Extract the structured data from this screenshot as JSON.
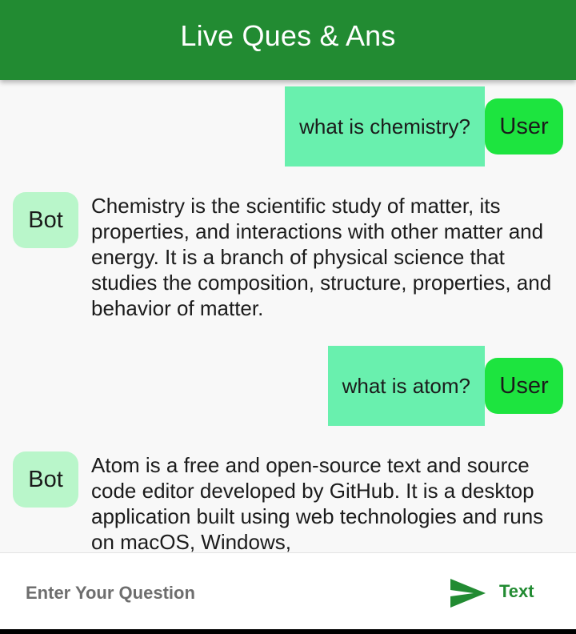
{
  "app_bar": {
    "title": "Live Ques & Ans"
  },
  "messages": [
    {
      "sender": "User",
      "text": "what is chemistry?"
    },
    {
      "sender": "Bot",
      "text": "Chemistry is the scientific study of matter, its properties, and interactions with other matter and energy. It is a branch of physical science that studies the composition, structure, properties, and behavior of matter."
    },
    {
      "sender": "User",
      "text": "what is atom?"
    },
    {
      "sender": "Bot",
      "text": "Atom is a free and open-source text and source code editor developed by GitHub. It is a desktop application built using web technologies and runs on macOS, Windows,"
    }
  ],
  "input": {
    "placeholder": "Enter Your Question",
    "value": ""
  },
  "send": {
    "label": "Text",
    "icon": "send-icon"
  },
  "colors": {
    "app_bar": "#228b32",
    "user_message": "#69f0ae",
    "user_tag": "#1de43f",
    "bot_tag": "#b9f6ca",
    "accent": "#228b32"
  }
}
